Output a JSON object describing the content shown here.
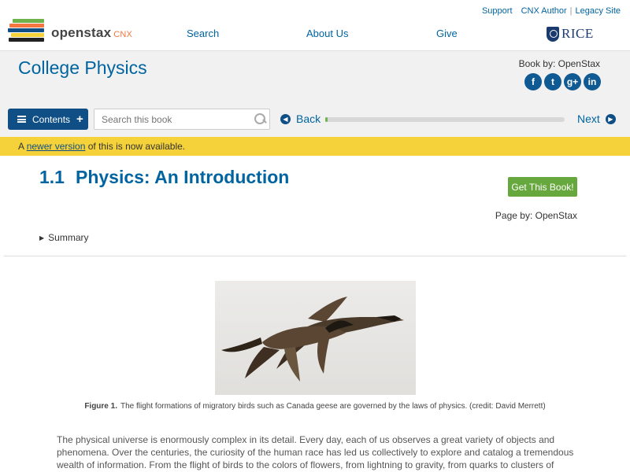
{
  "header": {
    "logo_name": "openstax",
    "logo_cnx": "CNX",
    "util_links": [
      "Support",
      "CNX Author",
      "Legacy Site"
    ],
    "nav": [
      "Search",
      "About Us",
      "Give"
    ],
    "rice_label": "RICE"
  },
  "book": {
    "title": "College Physics",
    "book_by": "Book by: OpenStax",
    "social_icons": [
      "facebook-icon",
      "twitter-icon",
      "google-plus-icon",
      "linkedin-icon"
    ]
  },
  "toolbar": {
    "contents_label": "Contents",
    "search_placeholder": "Search this book",
    "back_label": "Back",
    "next_label": "Next",
    "progress_fraction": 0.01
  },
  "notice": {
    "prefix": "A",
    "link": "newer version",
    "suffix": "of this is now available."
  },
  "page": {
    "number": "1.1",
    "title": "Physics: An Introduction",
    "get_book_label": "Get This Book!",
    "page_by": "Page by: OpenStax",
    "summary_label": "Summary"
  },
  "figure": {
    "label": "Figure 1.",
    "caption": "The flight formations of migratory birds such as Canada geese are governed by the laws of physics. (credit: David Merrett)"
  },
  "body_text": "The physical universe is enormously complex in its detail. Every day, each of us observes a great variety of objects and phenomena. Over the centuries, the curiosity of the human race has led us collectively to explore and catalog a tremendous wealth of information. From the flight of birds to the colors of flowers, from lightning to gravity, from quarks to clusters of galaxies, from the flow of time to",
  "colors": {
    "brand_blue": "#0064a0",
    "button_blue": "#0f4f86",
    "notice_yellow": "#f5d23a",
    "green": "#67a83e"
  }
}
